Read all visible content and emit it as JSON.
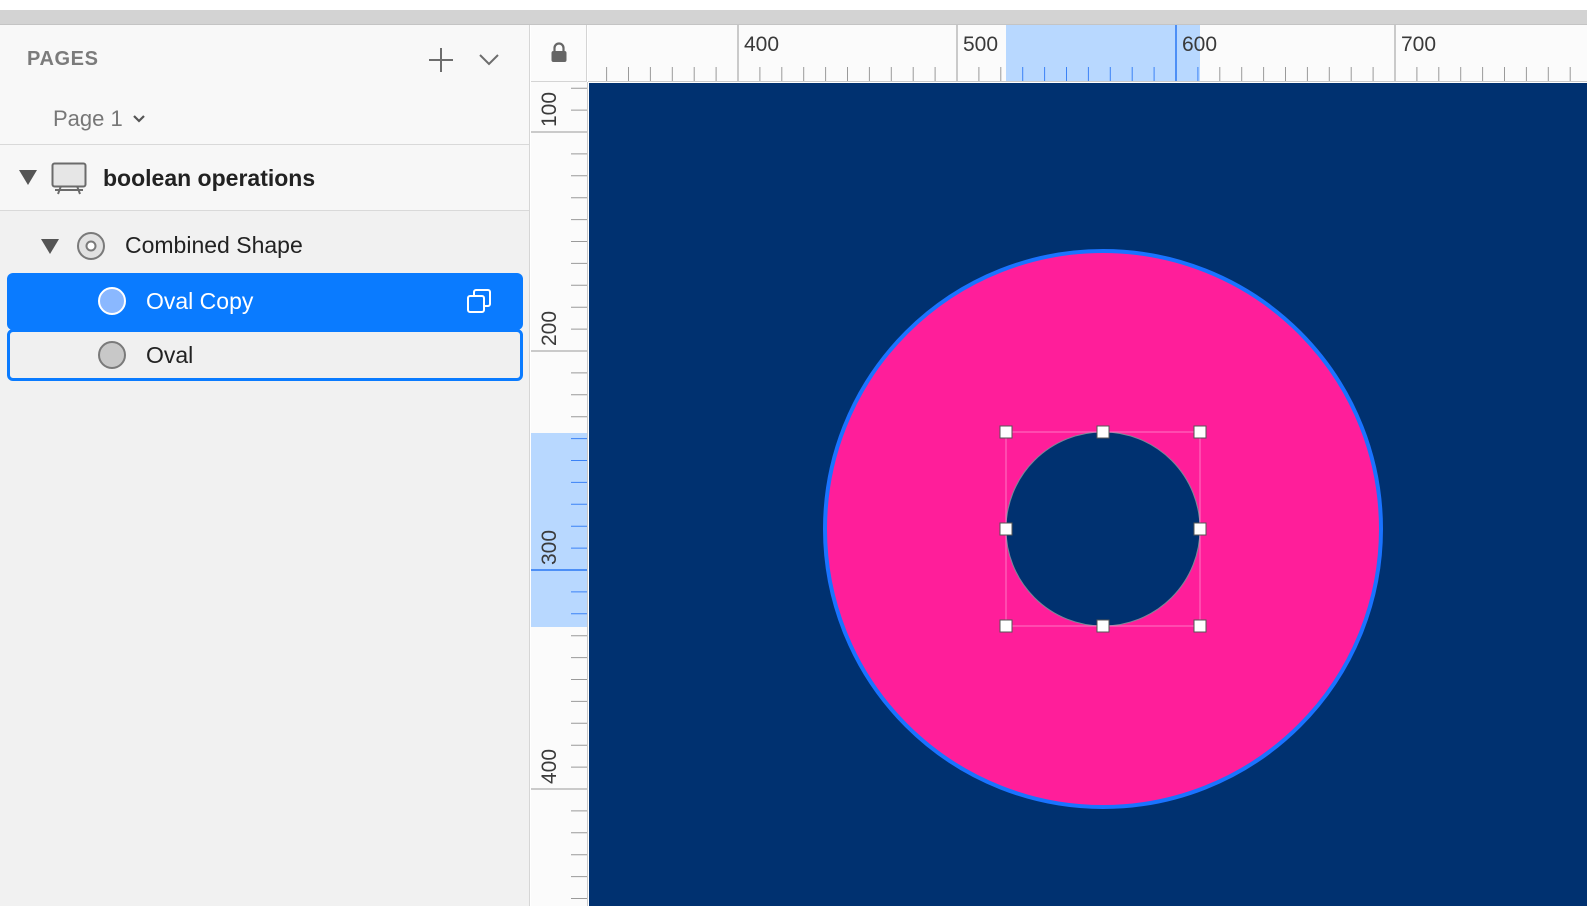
{
  "sidebar": {
    "pages_title": "PAGES",
    "page_selector": "Page 1",
    "artboard": {
      "label": "boolean operations"
    },
    "group": {
      "label": "Combined Shape"
    },
    "layers": [
      {
        "label": "Oval Copy",
        "selected": true
      },
      {
        "label": "Oval",
        "selected": false
      }
    ]
  },
  "ruler_h": {
    "labels": [
      "400",
      "500",
      "600",
      "700"
    ]
  },
  "ruler_v": {
    "labels": [
      "100",
      "200",
      "300",
      "400"
    ]
  },
  "colors": {
    "canvas_background": "#003170",
    "shape_fill": "#ff1e9a",
    "selection_blue": "#0a7bff",
    "ruler_highlight": "#b8d8ff"
  },
  "icons": {
    "add_page": "plus-icon",
    "pages_menu": "chevron-down-icon",
    "artboard": "artboard-icon",
    "combined_shape": "combined-shape-icon",
    "oval": "oval-icon",
    "boolean_mode": "boolean-mode-icon",
    "ruler_lock": "lock-icon"
  }
}
